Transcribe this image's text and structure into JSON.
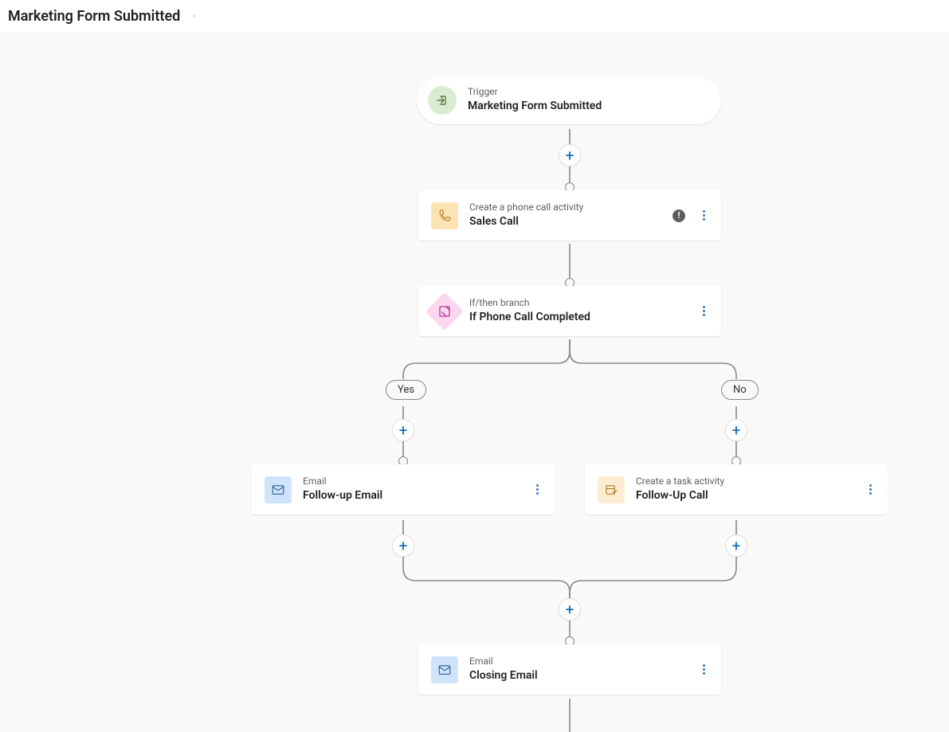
{
  "header": {
    "title": "Marketing Form Submitted"
  },
  "flow": {
    "trigger": {
      "kicker": "Trigger",
      "title": "Marketing Form Submitted"
    },
    "salesCall": {
      "kicker": "Create a phone call activity",
      "title": "Sales Call"
    },
    "branch": {
      "kicker": "If/then branch",
      "title": "If Phone Call Completed",
      "yesLabel": "Yes",
      "noLabel": "No"
    },
    "followUpEmail": {
      "kicker": "Email",
      "title": "Follow-up Email"
    },
    "followUpCall": {
      "kicker": "Create a task activity",
      "title": "Follow-Up Call"
    },
    "closingEmail": {
      "kicker": "Email",
      "title": "Closing Email"
    }
  },
  "icons": {
    "trigger": "enter-icon",
    "phone": "phone-icon",
    "branch": "note-icon",
    "email": "mail-icon",
    "task": "task-icon",
    "plus": "+",
    "warn": "!"
  },
  "colors": {
    "canvasBg": "#faf9f8",
    "accent": "#0067b8",
    "connector": "#888886"
  }
}
